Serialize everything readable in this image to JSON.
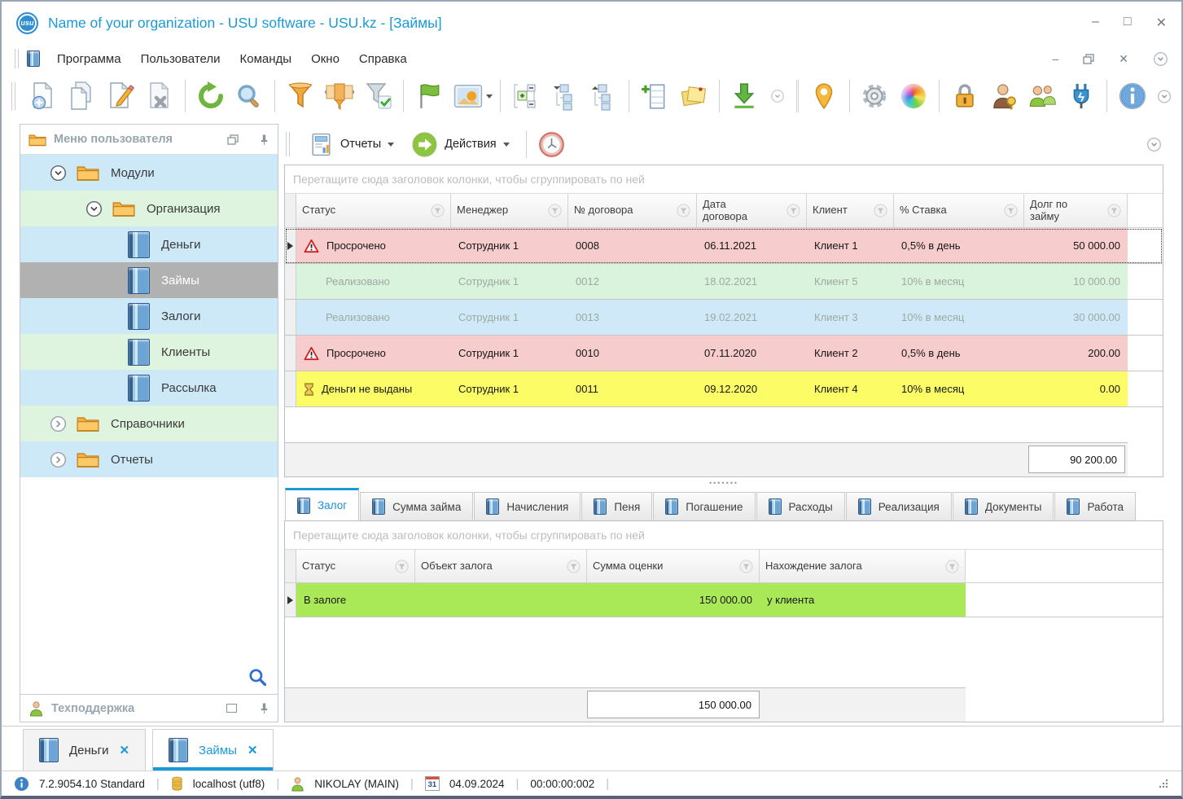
{
  "window": {
    "title": "Name of your organization - USU software - USU.kz - [Займы]",
    "logo": "usu"
  },
  "menu": {
    "items": [
      "Программа",
      "Пользователи",
      "Команды",
      "Окно",
      "Справка"
    ]
  },
  "toolbar": {
    "icons": [
      "new-document",
      "copy-document",
      "edit-document",
      "delete-document",
      "refresh",
      "search",
      "filter",
      "filter-columns",
      "filter-apply",
      "flag",
      "image",
      "expand-tree",
      "collapse-tree-down",
      "collapse-tree-up",
      "add-column",
      "notes",
      "export-download",
      "more",
      "location-pin",
      "settings-gear",
      "color-palette",
      "lock",
      "user-permissions",
      "user-groups",
      "plugin",
      "info"
    ]
  },
  "actions_toolbar": {
    "reports": "Отчеты",
    "actions": "Действия"
  },
  "sidebar": {
    "title": "Меню пользователя",
    "support": "Техподдержка",
    "tree": [
      {
        "label": "Модули",
        "type": "folder",
        "state": "expanded"
      },
      {
        "label": "Организация",
        "type": "folder",
        "state": "expanded"
      },
      {
        "label": "Деньги",
        "type": "book"
      },
      {
        "label": "Займы",
        "type": "book",
        "selected": true
      },
      {
        "label": "Залоги",
        "type": "book"
      },
      {
        "label": "Клиенты",
        "type": "book"
      },
      {
        "label": "Рассылка",
        "type": "book"
      },
      {
        "label": "Справочники",
        "type": "folder",
        "state": "collapsed"
      },
      {
        "label": "Отчеты",
        "type": "folder",
        "state": "collapsed"
      }
    ]
  },
  "main_grid": {
    "group_hint": "Перетащите сюда заголовок колонки, чтобы сгруппировать по ней",
    "columns": [
      "Статус",
      "Менеджер",
      "№ договора",
      "Дата договора",
      "Клиент",
      "% Ставка",
      "Долг по займу"
    ],
    "rows": [
      {
        "icon": "warning-icon",
        "status": "Просрочено",
        "manager": "Сотрудник 1",
        "number": "0008",
        "date": "06.11.2021",
        "client": "Клиент 1",
        "rate": "0,5% в день",
        "debt": "50 000.00",
        "color": "#F6CCCC",
        "selected": true
      },
      {
        "icon": "",
        "status": "Реализовано",
        "manager": "Сотрудник 1",
        "number": "0012",
        "date": "18.02.2021",
        "client": "Клиент 5",
        "rate": "10% в месяц",
        "debt": "10 000.00",
        "color": "#D9F3DC"
      },
      {
        "icon": "",
        "status": "Реализовано",
        "manager": "Сотрудник 1",
        "number": "0013",
        "date": "19.02.2021",
        "client": "Клиент 3",
        "rate": "10% в месяц",
        "debt": "30 000.00",
        "color": "#CFE9F8"
      },
      {
        "icon": "warning-icon",
        "status": "Просрочено",
        "manager": "Сотрудник 1",
        "number": "0010",
        "date": "07.11.2020",
        "client": "Клиент 2",
        "rate": "0,5% в день",
        "debt": "200.00",
        "color": "#F6CCCC"
      },
      {
        "icon": "hourglass-icon",
        "status": "Деньги не выданы",
        "manager": "Сотрудник 1",
        "number": "0011",
        "date": "09.12.2020",
        "client": "Клиент 4",
        "rate": "10% в месяц",
        "debt": "0.00",
        "color": "#FCFC66"
      }
    ],
    "total": "90 200.00"
  },
  "detail_tabs": [
    "Залог",
    "Сумма займа",
    "Начисления",
    "Пеня",
    "Погашение",
    "Расходы",
    "Реализация",
    "Документы",
    "Работа"
  ],
  "detail_grid": {
    "group_hint": "Перетащите сюда заголовок колонки, чтобы сгруппировать по ней",
    "columns": [
      "Статус",
      "Объект залога",
      "Сумма оценки",
      "Нахождение залога"
    ],
    "rows": [
      {
        "status": "В залоге",
        "object": "",
        "amount": "150 000.00",
        "location": "у клиента",
        "color": "#A9E957",
        "selected": true
      }
    ],
    "total": "150 000.00"
  },
  "dock_tabs": [
    "Деньги",
    "Займы"
  ],
  "status_bar": {
    "version": "7.2.9054.10 Standard",
    "database": "localhost (utf8)",
    "user": "NIKOLAY (MAIN)",
    "calendar_day": "31",
    "date": "04.09.2024",
    "timer": "00:00:00:002"
  },
  "colors": {
    "accent_blue": "#1A9AD7",
    "row_overdue": "#F6CCCC",
    "row_realized_green": "#D9F3DC",
    "row_realized_blue": "#CFE9F8",
    "row_money_not_issued": "#FCFC66",
    "row_pledged": "#A9E957",
    "tree_row_blue": "#CDE9F8",
    "tree_row_green": "#DEF4DF",
    "tree_selected_gray": "#B1B1B1"
  }
}
